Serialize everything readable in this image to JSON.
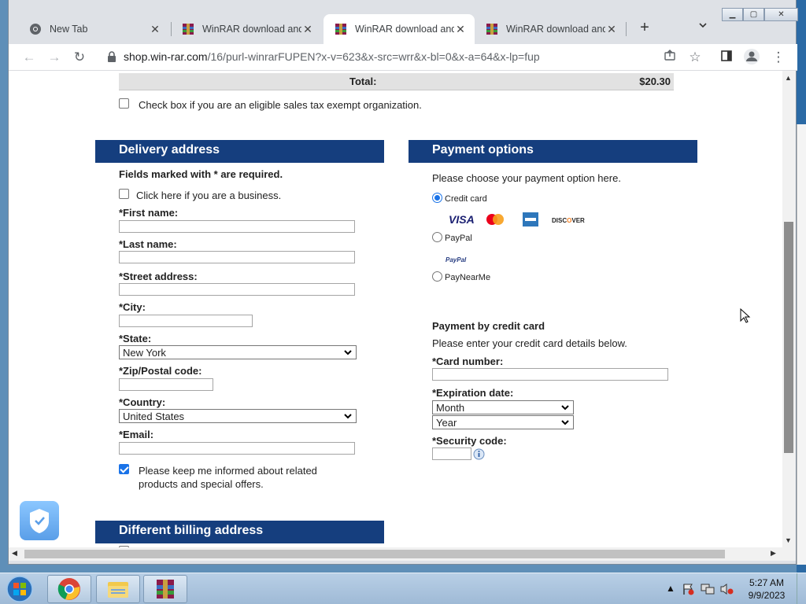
{
  "browser": {
    "tabs": [
      {
        "label": "New Tab",
        "icon": "chrome-icon"
      },
      {
        "label": "WinRAR download and",
        "icon": "winrar-icon"
      },
      {
        "label": "WinRAR download and",
        "icon": "winrar-icon"
      },
      {
        "label": "WinRAR download and",
        "icon": "winrar-icon"
      }
    ],
    "active_tab": 2,
    "new_tab_label": "+",
    "url_host": "shop.win-rar.com",
    "url_path": "/16/purl-winrarFUPEN?x-v=623&x-src=wrr&x-bl=0&x-a=64&x-lp=fup"
  },
  "order": {
    "total_label": "Total:",
    "total_value": "$20.30",
    "tax_exempt_label": "Check box if you are an eligible sales tax exempt organization.",
    "tax_exempt_checked": false
  },
  "delivery": {
    "heading": "Delivery address",
    "required_note": "Fields marked with * are required.",
    "business_label": "Click here if you are a business.",
    "business_checked": false,
    "first_name_label": "*First name:",
    "last_name_label": "*Last name:",
    "street_label": "*Street address:",
    "city_label": "*City:",
    "state_label": "*State:",
    "state_value": "New York",
    "zip_label": "*Zip/Postal code:",
    "country_label": "*Country:",
    "country_value": "United States",
    "email_label": "*Email:",
    "newsletter_line1": "Please keep me informed about related",
    "newsletter_line2": "products and special offers.",
    "newsletter_checked": true
  },
  "billing": {
    "heading": "Different billing address"
  },
  "payment": {
    "heading": "Payment options",
    "instruction": "Please choose your payment option here.",
    "options": [
      {
        "label": "Credit card",
        "selected": true
      },
      {
        "label": "PayPal",
        "selected": false
      },
      {
        "label": "PayNearMe",
        "selected": false
      }
    ],
    "card_logos": [
      "VISA",
      "mastercard",
      "amex",
      "DISCOVER"
    ],
    "paypal_logo": "PayPal",
    "cc_heading": "Payment by credit card",
    "cc_instruction": "Please enter your credit card details below.",
    "card_number_label": "*Card number:",
    "expiration_label": "*Expiration date:",
    "month_value": "Month",
    "year_value": "Year",
    "security_label": "*Security code:"
  },
  "taskbar": {
    "time": "5:27 AM",
    "date": "9/9/2023"
  },
  "colors": {
    "header_blue": "#153e7e",
    "checkbox_blue": "#1a73e8"
  }
}
